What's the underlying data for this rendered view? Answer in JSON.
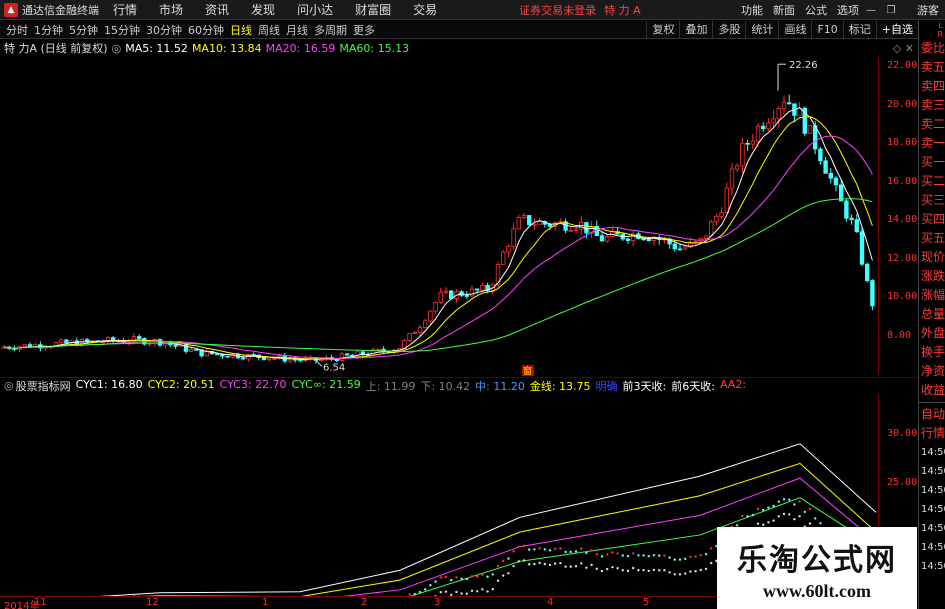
{
  "titlebar": {
    "app_name": "通达信金融终端",
    "menu": [
      "行情",
      "市场",
      "资讯",
      "发现",
      "问小达",
      "财富圈",
      "交易"
    ],
    "notice": "证券交易未登录",
    "stock_title": "特 力 A",
    "right_menu": [
      "功能",
      "新面",
      "公式",
      "选项"
    ],
    "user": "游客"
  },
  "toolbar": {
    "periods": [
      "分时",
      "1分钟",
      "5分钟",
      "15分钟",
      "30分钟",
      "60分钟",
      "日线",
      "周线",
      "月线",
      "多周期",
      "更多"
    ],
    "active_period": "日线",
    "right_buttons": [
      "复权",
      "叠加",
      "多股",
      "统计",
      "画线",
      "F10",
      "标记",
      "+自选"
    ]
  },
  "main_chart": {
    "stock_label": "特 力A (日线 前复权)",
    "ma": [
      {
        "label": "MA5: 11.52",
        "color": "#ffffff"
      },
      {
        "label": "MA10: 13.84",
        "color": "#ffff00"
      },
      {
        "label": "MA20: 16.59",
        "color": "#ff40ff"
      },
      {
        "label": "MA60: 15.13",
        "color": "#40ff40"
      }
    ],
    "high_label": "22.26",
    "low_label": "6.54",
    "y_ticks": [
      "22.00",
      "20.00",
      "18.00",
      "16.00",
      "14.00",
      "12.00",
      "10.00",
      "8.00"
    ],
    "marker": "窗"
  },
  "indicator": {
    "name": "股票指标网",
    "items": [
      {
        "label": "CYC1: 16.80",
        "color": "#ffffff"
      },
      {
        "label": "CYC2: 20.51",
        "color": "#ffff00"
      },
      {
        "label": "CYC3: 22.70",
        "color": "#ff40ff"
      },
      {
        "label": "CYC∞: 21.59",
        "color": "#40ff40"
      },
      {
        "label": "上: 11.99",
        "color": "#808080"
      },
      {
        "label": "下: 10.42",
        "color": "#808080"
      },
      {
        "label": "中: 11.20",
        "color": "#40a0ff"
      },
      {
        "label": "金线: 13.75",
        "color": "#ffff00"
      },
      {
        "label": "明确",
        "color": "#4040ff"
      },
      {
        "label": "前3天收:",
        "color": "#ffffff"
      },
      {
        "label": "前6天收:",
        "color": "#ffffff"
      },
      {
        "label": "AA2:",
        "color": "#ff4040"
      }
    ],
    "y_ticks": [
      "30.00",
      "25.00",
      "20.00",
      "15.00"
    ]
  },
  "dates": [
    "2014年",
    "11",
    "12",
    "1",
    "2",
    "3",
    "4",
    "5"
  ],
  "sidebar": {
    "top_labels": [
      "L",
      "R"
    ],
    "items": [
      "委比",
      "卖五",
      "卖四",
      "卖三",
      "卖二",
      "卖一",
      "买一",
      "买二",
      "买三",
      "买四",
      "买五",
      "现价",
      "涨跌",
      "涨幅",
      "总量",
      "外盘",
      "换手",
      "净资",
      "收益"
    ],
    "bottom_items": [
      "自动",
      "行情",
      "14:50",
      "14:50",
      "14:50",
      "14:50",
      "14:50",
      "14:50",
      "14:50"
    ]
  },
  "watermark": {
    "title": "乐淘公式网",
    "url": "www.60lt.com"
  },
  "colors": {
    "bg": "#000000",
    "up": "#ff3030",
    "down": "#40ffff",
    "axis": "#ff3030"
  }
}
